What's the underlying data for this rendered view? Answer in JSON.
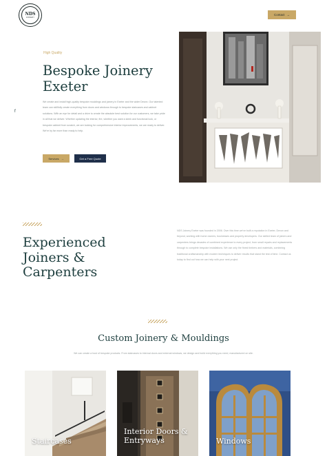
{
  "header": {
    "logo_text": "NDS",
    "logo_subtext": "JOINERY",
    "contact_label": "Contact",
    "contact_icon": "arrow-right-icon"
  },
  "sidebar": {
    "social_icon": "facebook-icon"
  },
  "hero": {
    "kicker": "High Quality",
    "title_line1": "Bespoke Joinery",
    "title_line2": "Exeter",
    "body": "We create and install high-quality bespoke mouldings and joinery in Exeter and the wider Devon. Our talented team can skillfully create everything from doors and windows through to bespoke staircases and cabinet solutions. With an eye for detail and a drive to create the absolute best solution for our customers, we take pride in all that we deliver. Whether updating the interior, fire, whether you want a sleek and functional look, or bespoke cabinet from scratch, we are looking for comprehensive interior improvements, we are ready to deliver. We're by far more than ready to help.",
    "primary_button": "Services",
    "secondary_button": "Get a Free Quote"
  },
  "experience": {
    "title_line1": "Experienced",
    "title_line2": "Joiners &",
    "title_line3": "Carpenters",
    "body": "NDS Joinery Exeter was founded in 2006. Over this time we've built a reputation in Exeter, Devon and beyond, working with home owners, businesses and property developers. Our skilled team of joiners and carpenters brings decades of combined experience to every project, from small repairs and replacements through to complete bespoke installations. We use only the finest timbers and materials, combining traditional craftsmanship with modern techniques to deliver results that stand the test of time. Contact us today to find out how we can help with your next project."
  },
  "custom": {
    "title": "Custom Joinery & Mouldings",
    "subtitle": "We can create a host of bespoke products. From staircases to internal doors and external windows, we design and build everything you need, manufactured on site."
  },
  "cards": [
    {
      "label": "Staircases"
    },
    {
      "label_line1": "Interior Doors &",
      "label_line2": "Entryways"
    },
    {
      "label": "Windows"
    }
  ]
}
